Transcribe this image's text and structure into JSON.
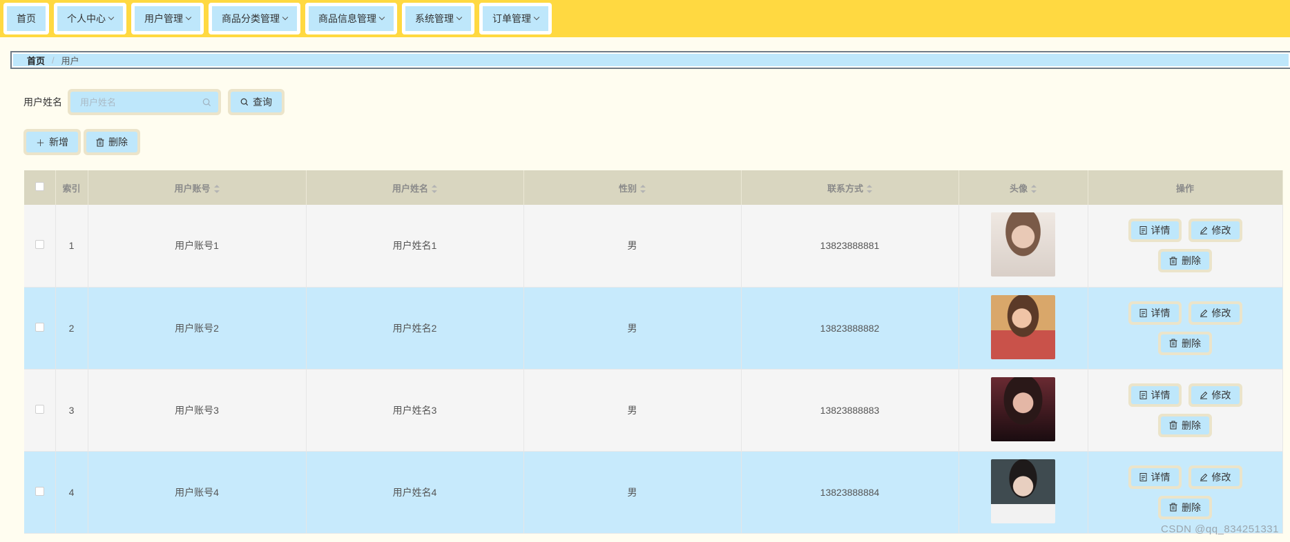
{
  "nav": {
    "items": [
      {
        "label": "首页",
        "has_menu": false
      },
      {
        "label": "个人中心",
        "has_menu": true
      },
      {
        "label": "用户管理",
        "has_menu": true
      },
      {
        "label": "商品分类管理",
        "has_menu": true
      },
      {
        "label": "商品信息管理",
        "has_menu": true
      },
      {
        "label": "系统管理",
        "has_menu": true
      },
      {
        "label": "订单管理",
        "has_menu": true
      }
    ]
  },
  "breadcrumb": {
    "home": "首页",
    "separator": "/",
    "current": "用户"
  },
  "search": {
    "label": "用户姓名",
    "placeholder": "用户姓名",
    "value": "",
    "button": "查询"
  },
  "actions": {
    "add": "新增",
    "delete": "删除"
  },
  "table": {
    "columns": {
      "index": "索引",
      "account": "用户账号",
      "name": "用户姓名",
      "gender": "性别",
      "phone": "联系方式",
      "avatar": "头像",
      "ops": "操作"
    },
    "rows": [
      {
        "index": "1",
        "account": "用户账号1",
        "name": "用户姓名1",
        "gender": "男",
        "phone": "13823888881"
      },
      {
        "index": "2",
        "account": "用户账号2",
        "name": "用户姓名2",
        "gender": "男",
        "phone": "13823888882"
      },
      {
        "index": "3",
        "account": "用户账号3",
        "name": "用户姓名3",
        "gender": "男",
        "phone": "13823888883"
      },
      {
        "index": "4",
        "account": "用户账号4",
        "name": "用户姓名4",
        "gender": "男",
        "phone": "13823888884"
      }
    ],
    "row_actions": {
      "detail": "详情",
      "edit": "修改",
      "delete": "删除"
    }
  },
  "watermark": "CSDN @qq_834251331",
  "colors": {
    "nav_bg": "#ffd941",
    "button_bg": "#bee7fb",
    "button_border": "#ebe4ca",
    "header_bg": "#d9d6c0",
    "row_highlight": "#c7eafc",
    "page_bg": "#fffdf0"
  }
}
